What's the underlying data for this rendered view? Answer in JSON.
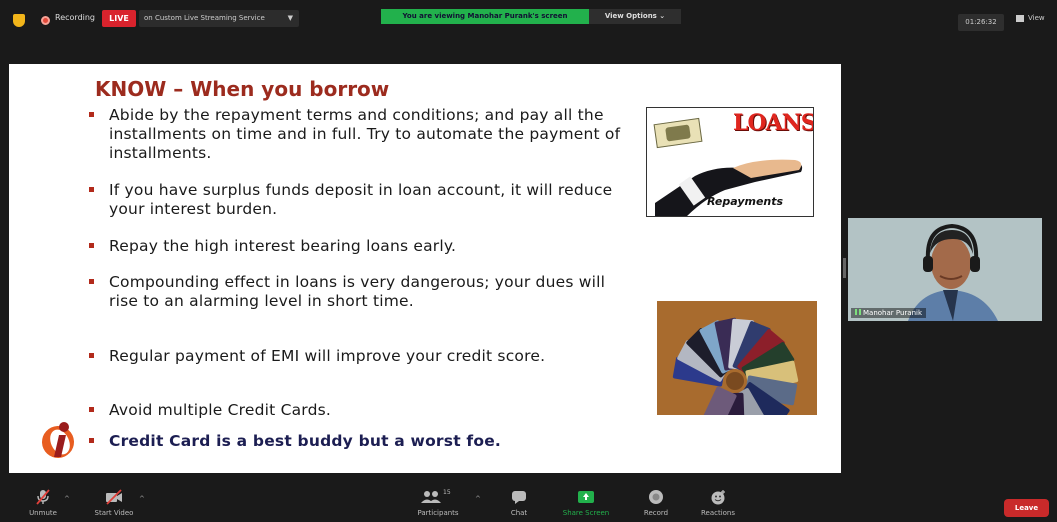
{
  "topbar": {
    "recording_label": "Recording",
    "live_label": "LIVE",
    "stream_service": "on Custom Live Streaming Service",
    "share_banner": "You are viewing Manohar Purank's screen",
    "view_options": "View Options",
    "timer": "01:26:32",
    "view_label": "View"
  },
  "slide": {
    "title": "KNOW – When you borrow",
    "bullets": [
      "Abide by the repayment terms and conditions; and pay all the installments on time and in full. Try to automate the payment of installments.",
      "If you have surplus funds deposit in loan account, it will reduce your interest burden.",
      "Repay the high interest bearing loans early.",
      "Compounding effect in loans is very dangerous; your dues will rise to an alarming level in short time.",
      "Regular payment of EMI will improve your credit score.",
      "Avoid multiple Credit Cards.",
      "Credit Card is a best buddy but a worst foe."
    ],
    "loans_image": {
      "word": "LOANS",
      "caption": "Repayments"
    }
  },
  "participant": {
    "name": "Manohar Puranik"
  },
  "toolbar": {
    "unmute": "Unmute",
    "start_video": "Start Video",
    "participants": "Participants",
    "participants_count": "15",
    "chat": "Chat",
    "share_screen": "Share Screen",
    "record": "Record",
    "reactions": "Reactions",
    "leave": "Leave"
  },
  "colors": {
    "title_red": "#9c2b1e",
    "bullet_red": "#b22a1b",
    "share_green": "#22b14c",
    "live_red": "#d9232d",
    "leave_red": "#c92a2a"
  }
}
